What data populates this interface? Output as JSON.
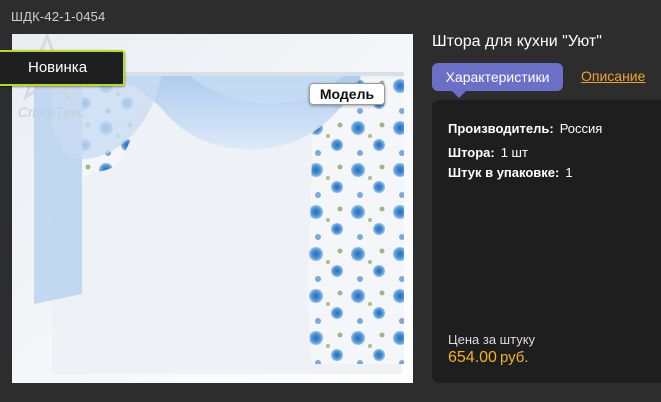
{
  "product": {
    "code": "ШДК-42-1-0454",
    "title": "Штора для кухни \"Уют\""
  },
  "badges": {
    "new": "Новинка",
    "model": "Модель"
  },
  "watermark": "СтарТекс",
  "tabs": {
    "characteristics": "Характеристики",
    "description": "Описание"
  },
  "specs": [
    {
      "label": "Производитель:",
      "value": "Россия"
    },
    {
      "label": "Штора:",
      "value": "1 шт"
    },
    {
      "label": "Штук в упаковке:",
      "value": "1"
    }
  ],
  "price": {
    "label": "Цена за штуку",
    "value": "654.00",
    "currency": "руб."
  },
  "colors": {
    "background": "#2d2d2d",
    "accent_tab": "#6b6fc8",
    "price": "#f4b323",
    "link": "#f0a12b",
    "badge_border": "#b6dc1f"
  }
}
